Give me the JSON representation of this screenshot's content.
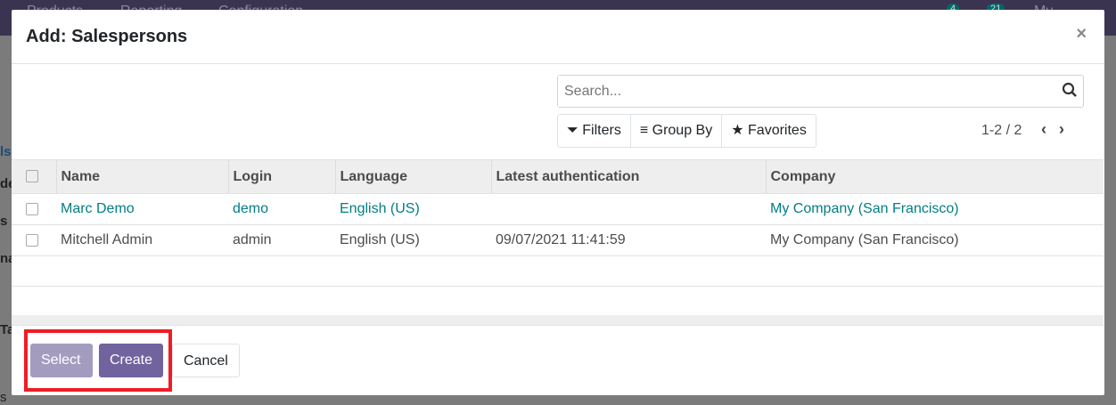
{
  "background": {
    "nav": [
      "Products",
      "Reporting",
      "Configuration"
    ],
    "badges": [
      "4",
      "21"
    ],
    "company": "My Company",
    "side_fragments": [
      "ls",
      "de",
      "s",
      "na",
      "Ta",
      "s"
    ]
  },
  "dialog": {
    "title": "Add: Salespersons",
    "close": "×"
  },
  "search": {
    "placeholder": "Search...",
    "icon": "search-icon"
  },
  "filters": {
    "filters": "Filters",
    "group_by": "Group By",
    "favorites": "Favorites"
  },
  "pager": {
    "text": "1-2 / 2",
    "prev": "‹",
    "next": "›"
  },
  "table": {
    "columns": [
      "Name",
      "Login",
      "Language",
      "Latest authentication",
      "Company"
    ],
    "rows": [
      [
        "Marc Demo",
        "demo",
        "English (US)",
        "",
        "My Company (San Francisco)"
      ],
      [
        "Mitchell Admin",
        "admin",
        "English (US)",
        "09/07/2021 11:41:59",
        "My Company (San Francisco)"
      ]
    ]
  },
  "footer": {
    "select": "Select",
    "create": "Create",
    "cancel": "Cancel"
  },
  "colors": {
    "primary": "#71639e",
    "link": "#017e84",
    "highlight": "#ee1c25"
  }
}
